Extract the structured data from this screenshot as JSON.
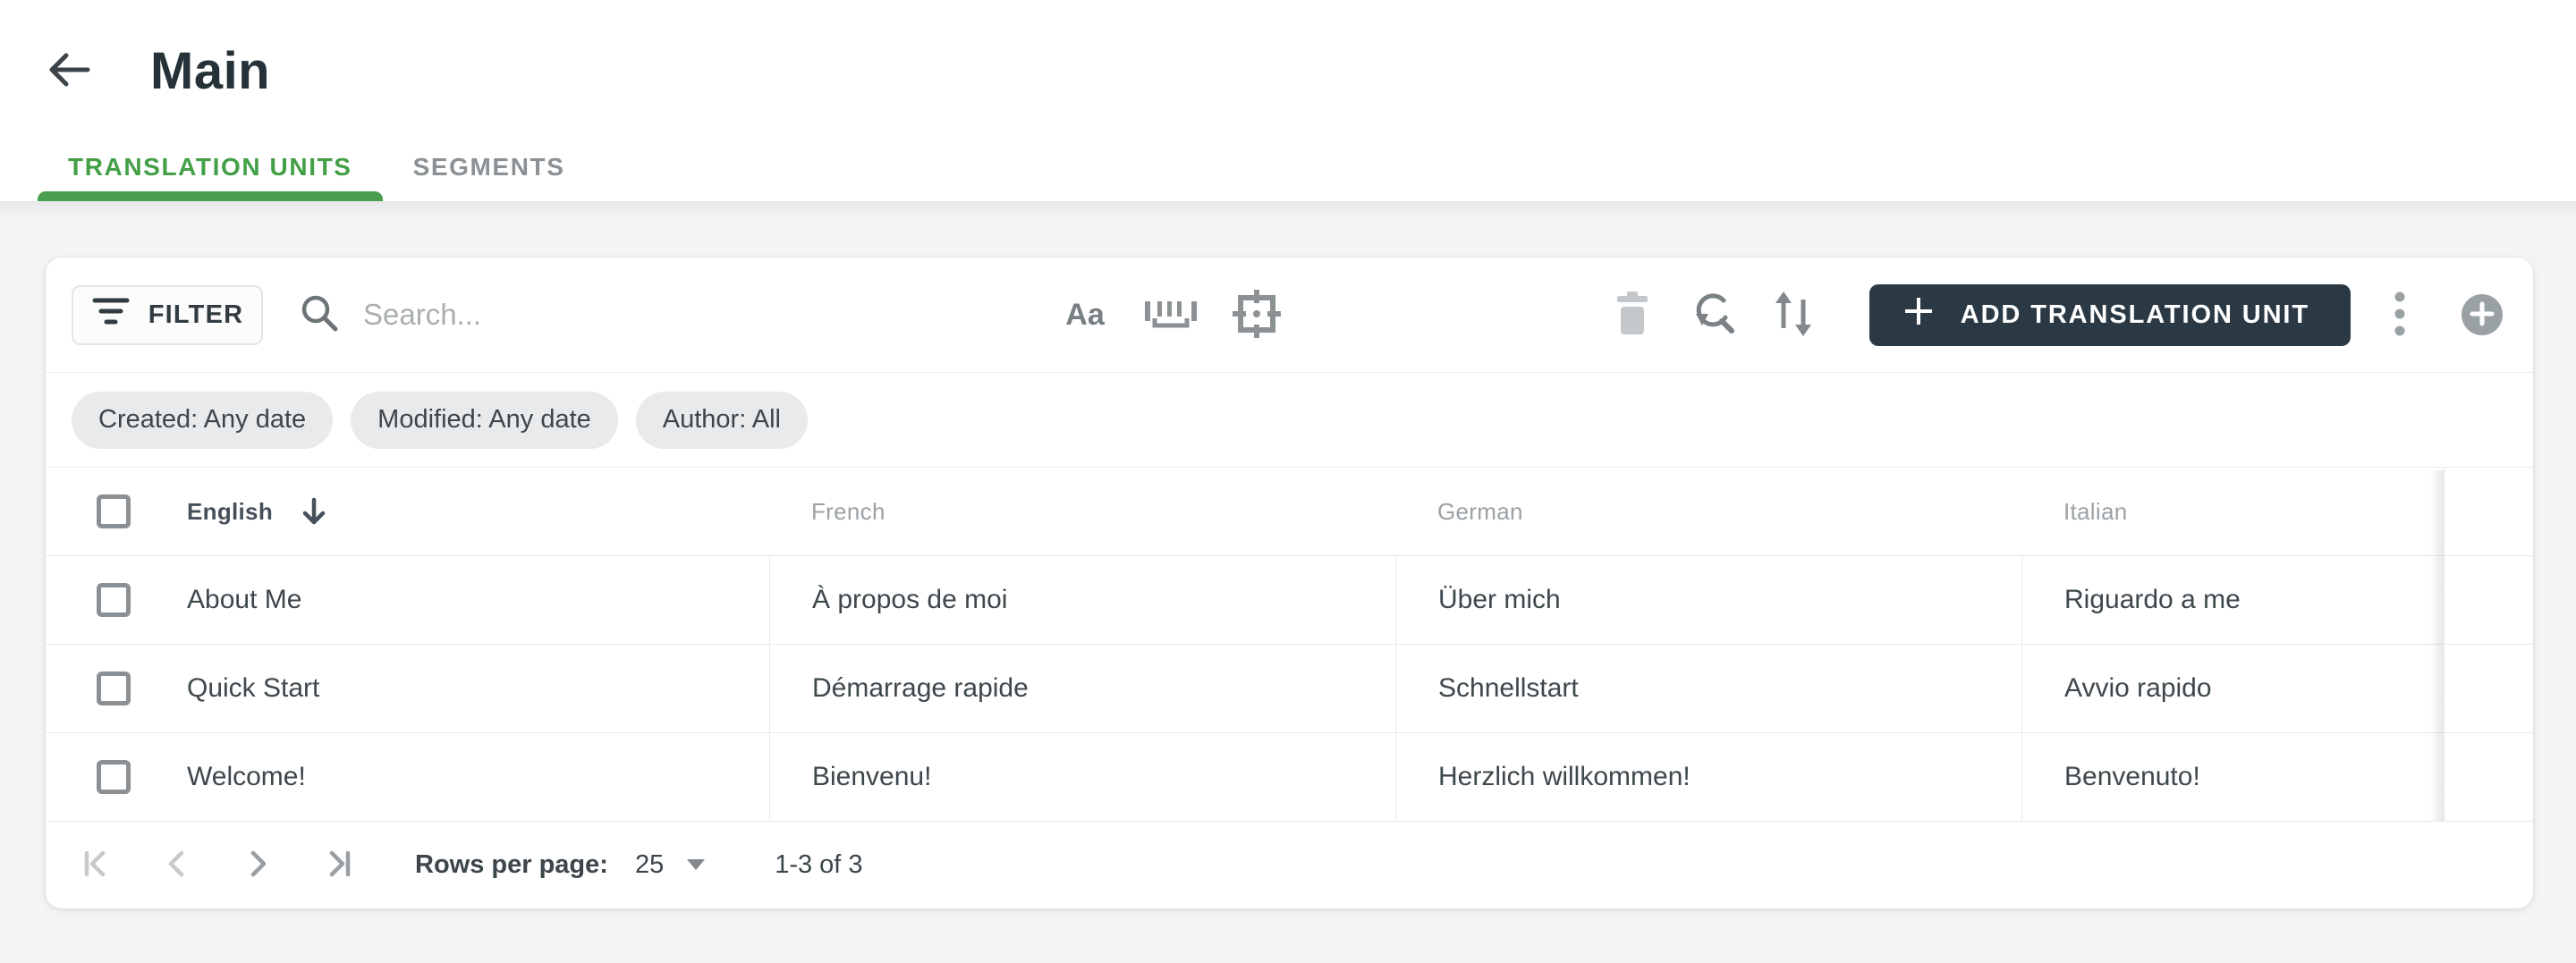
{
  "header": {
    "title": "Main"
  },
  "tabs": [
    {
      "label": "TRANSLATION UNITS",
      "active": true
    },
    {
      "label": "SEGMENTS",
      "active": false
    }
  ],
  "toolbar": {
    "filter_label": "FILTER",
    "search_placeholder": "Search...",
    "match_case_label": "Aa",
    "add_button_label": "ADD TRANSLATION UNIT"
  },
  "filter_chips": [
    "Created: Any date",
    "Modified: Any date",
    "Author: All"
  ],
  "table": {
    "columns": [
      "English",
      "French",
      "German",
      "Italian"
    ],
    "sort": {
      "column": "English",
      "direction": "descending"
    },
    "rows": [
      {
        "english": "About Me",
        "french": "À propos de moi",
        "german": "Über mich",
        "italian": "Riguardo a me"
      },
      {
        "english": "Quick Start",
        "french": "Démarrage rapide",
        "german": "Schnellstart",
        "italian": "Avvio rapido"
      },
      {
        "english": "Welcome!",
        "french": "Bienvenu!",
        "german": "Herzlich willkommen!",
        "italian": "Benvenuto!"
      }
    ]
  },
  "pagination": {
    "rows_per_page_label": "Rows per page:",
    "rows_per_page_value": "25",
    "range_label": "1-3 of 3"
  },
  "icons": {
    "back": "arrow-left",
    "filter": "filter-lines",
    "search": "magnifier",
    "match_case": "letters-Aa",
    "whole_word": "word-brackets",
    "selection": "frame-crosshair",
    "delete": "trash",
    "find_replace": "search-refresh",
    "sort": "arrows-up-down",
    "add": "plus",
    "more": "kebab-vertical",
    "add_circle": "plus-circle",
    "sort_indicator": "arrow-down",
    "first_page": "chevron-left-bar",
    "prev_page": "chevron-left",
    "next_page": "chevron-right",
    "last_page": "chevron-right-bar",
    "rows_per_page_caret": "triangle-down"
  },
  "colors": {
    "accent_green": "#43a047",
    "dark_button_bg": "#2b3945",
    "chip_bg": "#e9eaeb",
    "icon_gray": "#81888c",
    "disabled_icon_gray": "#c4c8ca",
    "text_dark": "#263238",
    "cell_text": "#3e474c",
    "muted_text": "#9ba1a5",
    "row_border": "#e7e9ea",
    "page_bg": "#f3f4f5"
  }
}
